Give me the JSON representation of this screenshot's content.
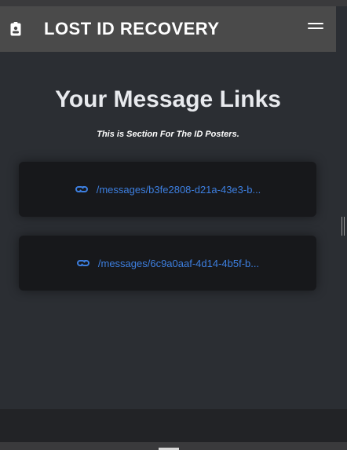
{
  "navbar": {
    "brand": "LOST ID RECOVERY",
    "brand_icon": "id-badge-icon",
    "menu_icon": "hamburger-menu-icon"
  },
  "main": {
    "title": "Your Message Links",
    "subtitle": "This is Section For The ID Posters.",
    "links": [
      {
        "icon": "link-icon",
        "text": "/messages/b3fe2808-d21a-43e3-b..."
      },
      {
        "icon": "link-icon",
        "text": "/messages/6c9a0aaf-4d14-4b5f-b..."
      }
    ]
  },
  "colors": {
    "background": "#2b2e33",
    "navbar": "#4a4a4a",
    "card": "#17181b",
    "link": "#3d7fe0",
    "title": "#e8eaee"
  }
}
